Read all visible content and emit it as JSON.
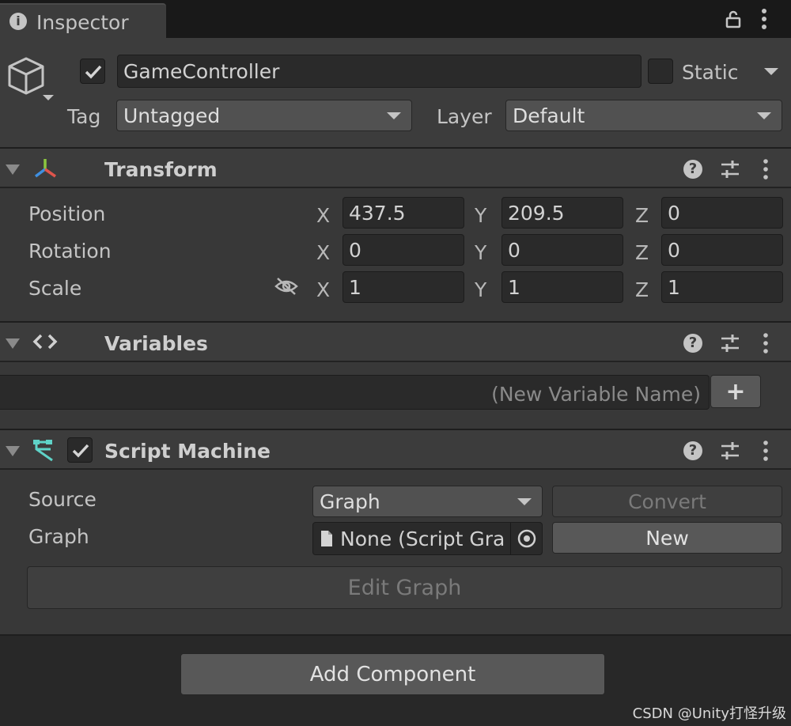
{
  "window": {
    "tab_label": "Inspector"
  },
  "object": {
    "name": "GameController",
    "active": true,
    "static_label": "Static",
    "static_checked": false,
    "tag_label": "Tag",
    "tag_value": "Untagged",
    "layer_label": "Layer",
    "layer_value": "Default"
  },
  "transform": {
    "title": "Transform",
    "rows": [
      {
        "label": "Position",
        "x": "437.5",
        "y": "209.5",
        "z": "0"
      },
      {
        "label": "Rotation",
        "x": "0",
        "y": "0",
        "z": "0"
      },
      {
        "label": "Scale",
        "x": "1",
        "y": "1",
        "z": "1"
      }
    ],
    "axes": {
      "x": "X",
      "y": "Y",
      "z": "Z"
    }
  },
  "variables": {
    "title": "Variables",
    "new_placeholder": "(New Variable Name)",
    "add_label": "+"
  },
  "script_machine": {
    "title": "Script Machine",
    "enabled": true,
    "source_label": "Source",
    "source_value": "Graph",
    "convert_label": "Convert",
    "graph_label": "Graph",
    "graph_value": "None (Script Gra",
    "new_label": "New",
    "edit_graph_label": "Edit Graph"
  },
  "add_component_label": "Add Component",
  "watermark": "CSDN @Unity打怪升级",
  "colors": {
    "accent_x": "#e0554c",
    "accent_y": "#8cc63f",
    "accent_z": "#3f8fe0",
    "script_icon": "#5fd3c8"
  }
}
